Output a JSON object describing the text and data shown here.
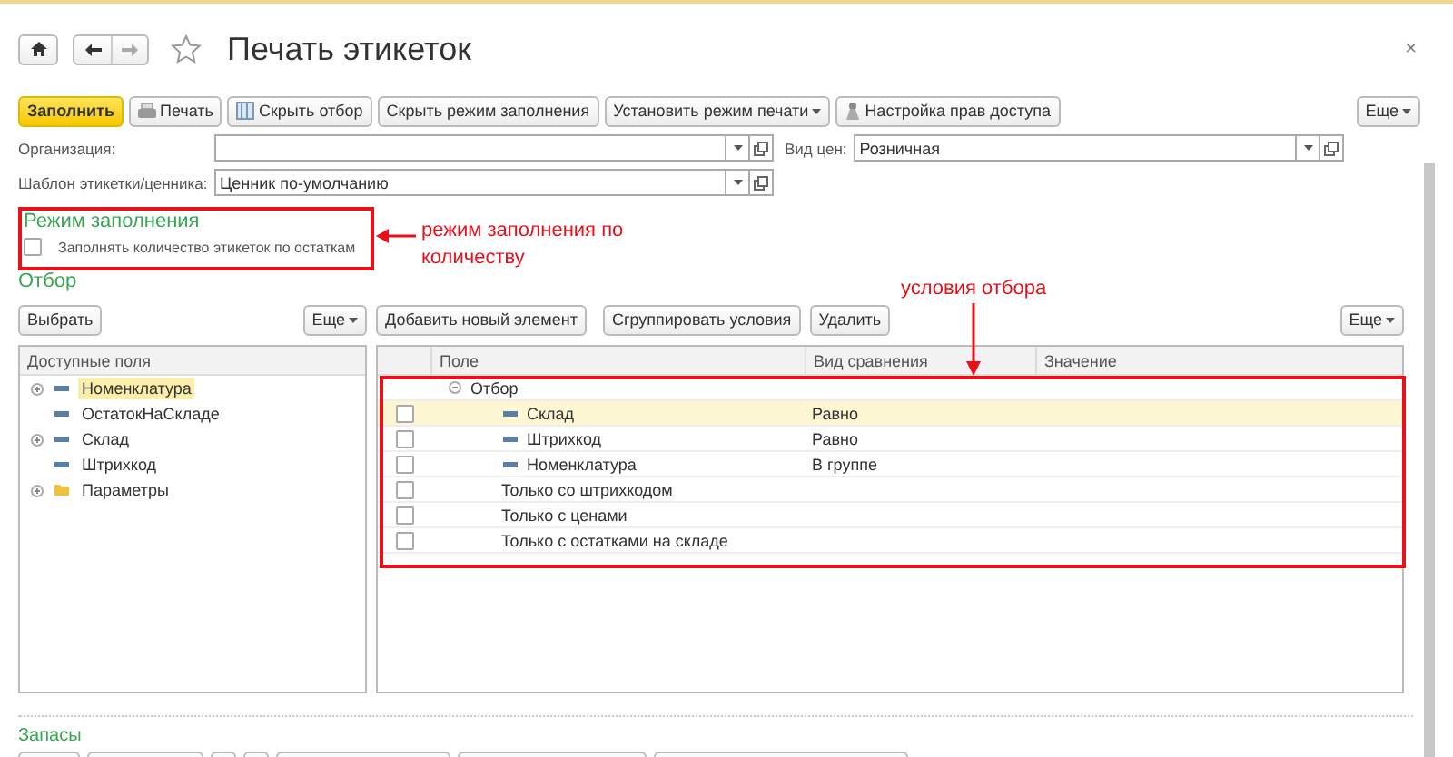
{
  "window": {
    "title": "Печать этикеток",
    "close": "×"
  },
  "toolbar": {
    "buttons": [
      {
        "label": "Заполнить",
        "kind": "primary"
      },
      {
        "label": "Печать",
        "kind": "printer"
      },
      {
        "label": "Скрыть отбор",
        "kind": "filter"
      },
      {
        "label": "Скрыть режим заполнения",
        "kind": "plain"
      },
      {
        "label": "Установить режим печати",
        "kind": "dropdown"
      },
      {
        "label": "Настройка прав доступа",
        "kind": "person"
      }
    ],
    "more": "Еще"
  },
  "fields": [
    {
      "label": "Организация:"
    },
    {
      "label": "Шаблон этикетки/ценника:",
      "value": "Ценник по-умолчанию"
    }
  ],
  "price_type": {
    "label": "Вид цен:",
    "value": "Розничная"
  },
  "fill_mode": {
    "title": "Режим заполнения",
    "option": {
      "label": "Заполнять количество этикеток по остаткам",
      "checked": false
    }
  },
  "filter": {
    "title": "Отбор",
    "left_toolbar": {
      "select": "Выбрать",
      "more": "Еще"
    },
    "right_toolbar": {
      "buttons": [
        "Добавить новый элемент",
        "Сгруппировать условия",
        "Удалить"
      ],
      "more": "Еще"
    },
    "available_fields": {
      "header": "Доступные поля",
      "items": [
        {
          "label": "Номенклатура",
          "kind": "field",
          "expandable": true,
          "selected": true
        },
        {
          "label": "ОстатокНаСкладе",
          "kind": "field",
          "expandable": false,
          "selected": false
        },
        {
          "label": "Склад",
          "kind": "field",
          "expandable": true,
          "selected": false
        },
        {
          "label": "Штрихкод",
          "kind": "field",
          "expandable": false,
          "selected": false
        },
        {
          "label": "Параметры",
          "kind": "folder",
          "expandable": true,
          "selected": false
        }
      ]
    },
    "conditions": {
      "columns": [
        "Поле",
        "Вид сравнения",
        "Значение"
      ],
      "rows": [
        {
          "field": "Отбор",
          "kind": "group",
          "expanded": true,
          "children": [
            {
              "field": "Склад",
              "kind": "field",
              "comparison": "Равно",
              "checked": false,
              "selected": true
            },
            {
              "field": "Штрихкод",
              "kind": "field",
              "comparison": "Равно",
              "checked": false,
              "selected": false
            },
            {
              "field": "Номенклатура",
              "kind": "field",
              "comparison": "В группе",
              "checked": false,
              "selected": false
            },
            {
              "field": "Только со штрихкодом",
              "kind": "option",
              "checked": false,
              "selected": false
            },
            {
              "field": "Только с ценами",
              "kind": "option",
              "checked": false,
              "selected": false
            },
            {
              "field": "Только с остатками на складе",
              "kind": "option",
              "checked": false,
              "selected": false
            }
          ]
        }
      ]
    }
  },
  "stock": {
    "title": "Запасы"
  },
  "annotations": [
    {
      "text": "режим заполнения по количеству",
      "kind": "left"
    },
    {
      "text": "условия отбора",
      "kind": "down"
    }
  ]
}
